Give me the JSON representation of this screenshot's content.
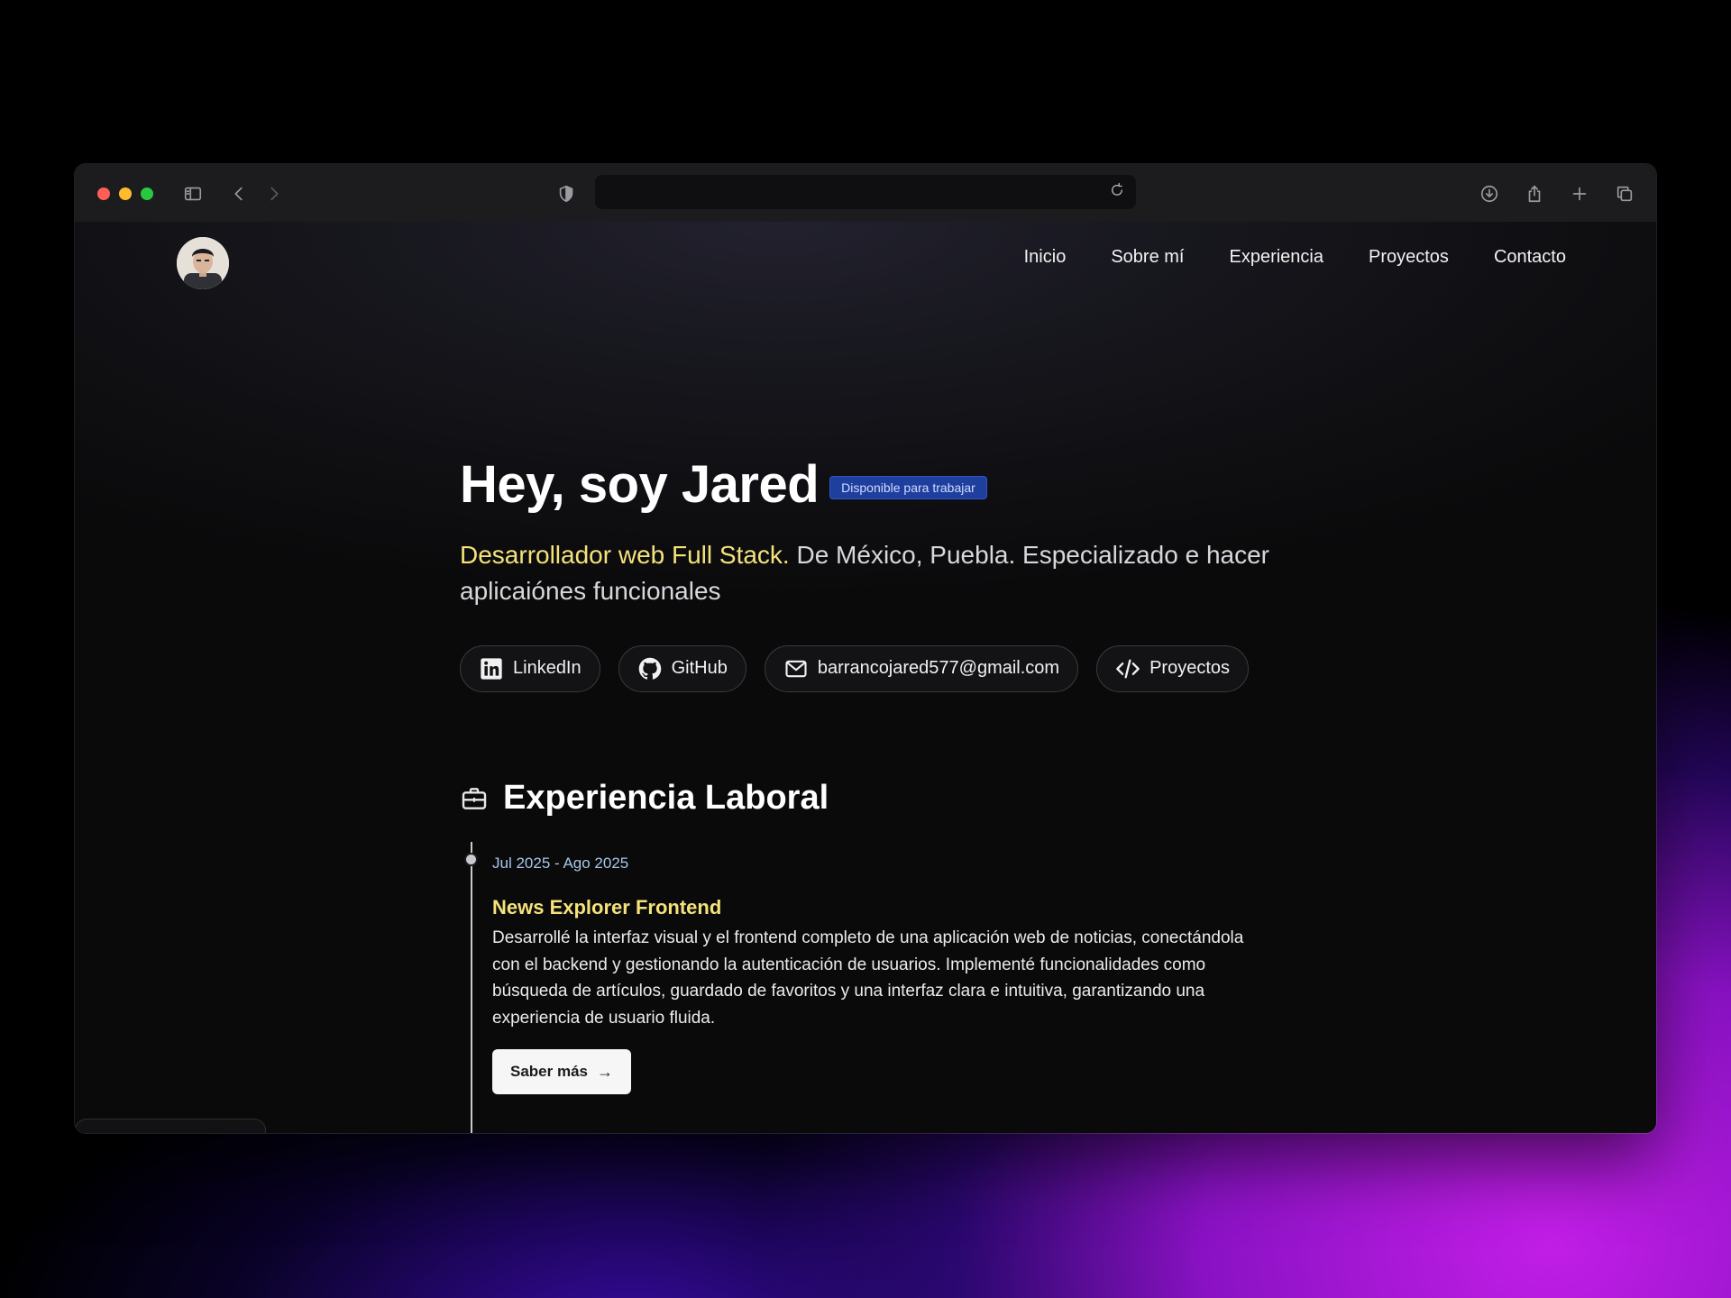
{
  "nav": {
    "items": [
      "Inicio",
      "Sobre mí",
      "Experiencia",
      "Proyectos",
      "Contacto"
    ]
  },
  "hero": {
    "title": "Hey, soy Jared",
    "badge": "Disponible para trabajar",
    "subtitle_accent": "Desarrollador web Full Stack.",
    "subtitle_rest": " De México, Puebla. Especializado e hacer aplicaiónes funcionales",
    "buttons": {
      "linkedin": "LinkedIn",
      "github": "GitHub",
      "email": "barrancojared577@gmail.com",
      "projects": "Proyectos"
    }
  },
  "experience": {
    "section_title": "Experiencia Laboral",
    "entries": [
      {
        "date": "Jul 2025 - Ago 2025",
        "title": "News Explorer Frontend",
        "description": "Desarrollé la interfaz visual y el frontend completo de una aplicación web de noticias, conectándola con el backend y gestionando la autenticación de usuarios. Implementé funcionalidades como búsqueda de artículos, guardado de favoritos y una interfaz clara e intuitiva, garantizando una experiencia de usuario fluida.",
        "button": "Saber más"
      }
    ]
  },
  "colors": {
    "accent_yellow": "#f5e27a",
    "badge_blue": "#1f3f9e",
    "date_blue": "#a9c7e8"
  },
  "icons": {
    "sidebar": "sidebar-icon",
    "back": "chevron-left-icon",
    "forward": "chevron-right-icon",
    "privacy": "shield-icon",
    "reload": "reload-icon",
    "download": "download-icon",
    "share": "share-icon",
    "new_tab": "plus-icon",
    "tabs": "tabs-icon"
  }
}
